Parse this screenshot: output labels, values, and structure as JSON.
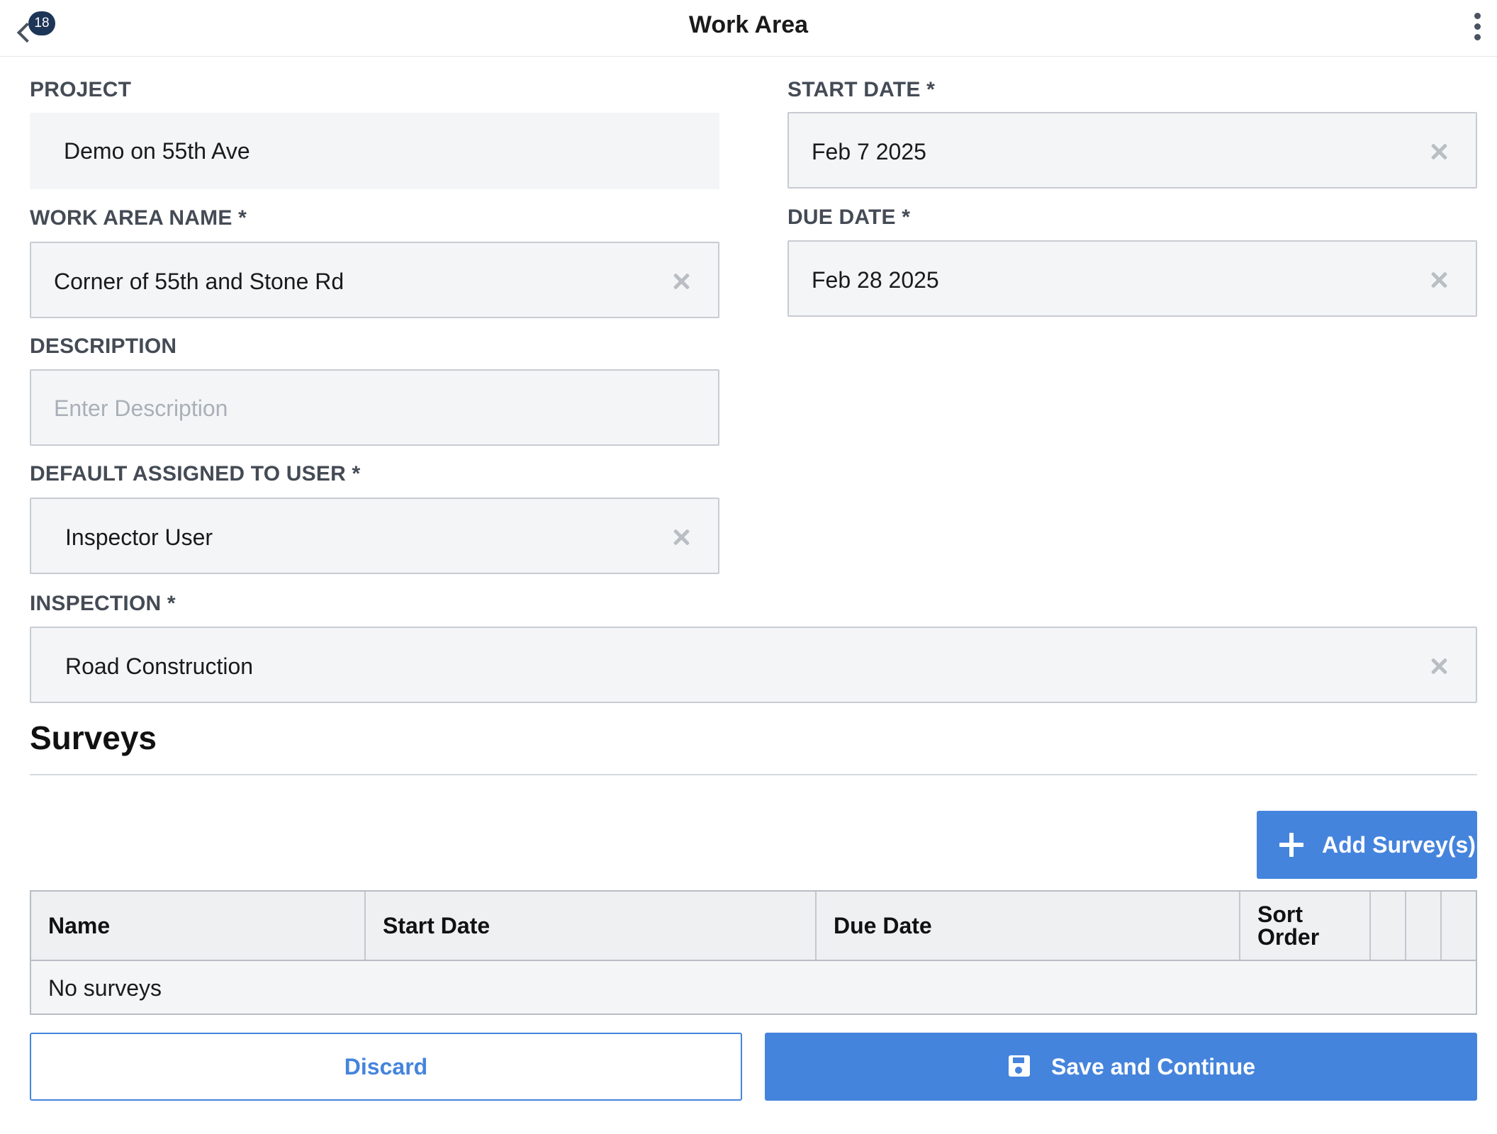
{
  "header": {
    "title": "Work Area",
    "back_badge": "18",
    "back_icon": "chevron-left-icon",
    "menu_icon": "more-vertical-icon"
  },
  "form": {
    "project": {
      "label": "PROJECT",
      "value": "Demo on 55th Ave"
    },
    "work_area_name": {
      "label": "WORK AREA NAME *",
      "value": "Corner of 55th and Stone Rd"
    },
    "description": {
      "label": "DESCRIPTION",
      "value": "",
      "placeholder": "Enter Description"
    },
    "default_assigned_user": {
      "label": "DEFAULT ASSIGNED TO USER *",
      "value": "Inspector User"
    },
    "inspection": {
      "label": "INSPECTION *",
      "value": "Road Construction"
    },
    "start_date": {
      "label": "START DATE *",
      "value": "Feb 7 2025"
    },
    "due_date": {
      "label": "DUE DATE *",
      "value": "Feb 28 2025"
    }
  },
  "surveys": {
    "title": "Surveys",
    "add_button_label": "Add Survey(s)",
    "columns": [
      "Name",
      "Start Date",
      "Due Date",
      "Sort Order"
    ],
    "empty_text": "No surveys"
  },
  "actions": {
    "discard_label": "Discard",
    "save_label": "Save and Continue"
  },
  "colors": {
    "accent": "#4584dc",
    "badge": "#1d3557",
    "field_bg": "#f4f5f7"
  }
}
